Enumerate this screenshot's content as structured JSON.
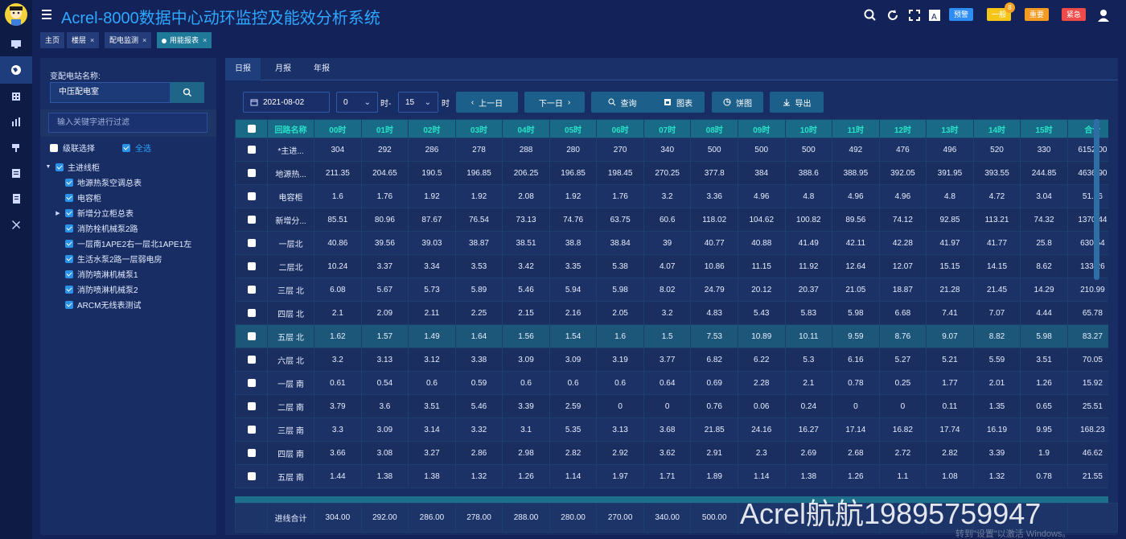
{
  "app": {
    "title": "Acrel-8000数据中心动环监控及能效分析系统"
  },
  "header": {
    "alerts": [
      {
        "label": "预警",
        "color": "#2e8df2"
      },
      {
        "label": "一般",
        "color": "#f5c518",
        "count": "8"
      },
      {
        "label": "重要",
        "color": "#f39a22"
      },
      {
        "label": "紧急",
        "color": "#f04b4b"
      }
    ],
    "icons": [
      "search-icon",
      "refresh-icon",
      "fullscreen-icon",
      "font-size-icon",
      "user-icon"
    ]
  },
  "page_tabs": [
    {
      "label": "主页",
      "closable": false
    },
    {
      "label": "楼层",
      "closable": true
    },
    {
      "label": "配电监测",
      "closable": true
    },
    {
      "label": "用能报表",
      "closable": true,
      "active": true
    }
  ],
  "left": {
    "station_label": "变配电站名称:",
    "station_value": "中压配电室",
    "filter_placeholder": "输入关键字进行过滤",
    "level_select": "级联选择",
    "select_all": "全选",
    "tree": [
      {
        "label": "主进线柜",
        "level": 0,
        "arrow": "▼",
        "checked": true
      },
      {
        "label": "地源热泵空调总表",
        "level": 1,
        "checked": true
      },
      {
        "label": "电容柜",
        "level": 1,
        "checked": true
      },
      {
        "label": "新增分立柜总表",
        "level": 1,
        "arrow": "▶",
        "checked": true
      },
      {
        "label": "消防栓机械泵2路",
        "level": 1,
        "checked": true
      },
      {
        "label": "一层南1APE2右一层北1APE1左",
        "level": 1,
        "checked": true
      },
      {
        "label": "生活水泵2路一层弱电房",
        "level": 1,
        "checked": true
      },
      {
        "label": "消防喷淋机械泵1",
        "level": 1,
        "checked": true
      },
      {
        "label": "消防喷淋机械泵2",
        "level": 1,
        "checked": true
      },
      {
        "label": "ARCM无线表测试",
        "level": 1,
        "checked": true
      }
    ]
  },
  "report": {
    "tabs": [
      "日报",
      "月报",
      "年报"
    ],
    "date": "2021-08-02",
    "hour_from": "0",
    "hour_sep": "时-",
    "hour_to": "15",
    "hour_suffix": "时",
    "buttons": {
      "prev": "上一日",
      "next": "下一日",
      "query": "查询",
      "chart": "图表",
      "pie": "饼图",
      "export": "导出"
    },
    "columns": [
      "回路名称",
      "00时",
      "01时",
      "02时",
      "03时",
      "04时",
      "05时",
      "06时",
      "07时",
      "08时",
      "09时",
      "10时",
      "11时",
      "12时",
      "13时",
      "14时",
      "15时",
      "合计"
    ],
    "rows": [
      [
        "*主进...",
        "304",
        "292",
        "286",
        "278",
        "288",
        "280",
        "270",
        "340",
        "500",
        "500",
        "500",
        "492",
        "476",
        "496",
        "520",
        "330",
        "6152.00"
      ],
      [
        "地源热...",
        "211.35",
        "204.65",
        "190.5",
        "196.85",
        "206.25",
        "196.85",
        "198.45",
        "270.25",
        "377.8",
        "384",
        "388.6",
        "388.95",
        "392.05",
        "391.95",
        "393.55",
        "244.85",
        "4636.90"
      ],
      [
        "电容柜",
        "1.6",
        "1.76",
        "1.92",
        "1.92",
        "2.08",
        "1.92",
        "1.76",
        "3.2",
        "3.36",
        "4.96",
        "4.8",
        "4.96",
        "4.96",
        "4.8",
        "4.72",
        "3.04",
        "51.76"
      ],
      [
        "新增分...",
        "85.51",
        "80.96",
        "87.67",
        "76.54",
        "73.13",
        "74.76",
        "63.75",
        "60.6",
        "118.02",
        "104.62",
        "100.82",
        "89.56",
        "74.12",
        "92.85",
        "113.21",
        "74.32",
        "1370.44"
      ],
      [
        "一层北",
        "40.86",
        "39.56",
        "39.03",
        "38.87",
        "38.51",
        "38.8",
        "38.84",
        "39",
        "40.77",
        "40.88",
        "41.49",
        "42.11",
        "42.28",
        "41.97",
        "41.77",
        "25.8",
        "630.54"
      ],
      [
        "二层北",
        "10.24",
        "3.37",
        "3.34",
        "3.53",
        "3.42",
        "3.35",
        "5.38",
        "4.07",
        "10.86",
        "11.15",
        "11.92",
        "12.64",
        "12.07",
        "15.15",
        "14.15",
        "8.62",
        "133.26"
      ],
      [
        "三层 北",
        "6.08",
        "5.67",
        "5.73",
        "5.89",
        "5.46",
        "5.94",
        "5.98",
        "8.02",
        "24.79",
        "20.12",
        "20.37",
        "21.05",
        "18.87",
        "21.28",
        "21.45",
        "14.29",
        "210.99"
      ],
      [
        "四层 北",
        "2.1",
        "2.09",
        "2.11",
        "2.25",
        "2.15",
        "2.16",
        "2.05",
        "3.2",
        "4.83",
        "5.43",
        "5.83",
        "5.98",
        "6.68",
        "7.41",
        "7.07",
        "4.44",
        "65.78"
      ],
      [
        "五层 北",
        "1.62",
        "1.57",
        "1.49",
        "1.64",
        "1.56",
        "1.54",
        "1.6",
        "1.5",
        "7.53",
        "10.89",
        "10.11",
        "9.59",
        "8.76",
        "9.07",
        "8.82",
        "5.98",
        "83.27"
      ],
      [
        "六层 北",
        "3.2",
        "3.13",
        "3.12",
        "3.38",
        "3.09",
        "3.09",
        "3.19",
        "3.77",
        "6.82",
        "6.22",
        "5.3",
        "6.16",
        "5.27",
        "5.21",
        "5.59",
        "3.51",
        "70.05"
      ],
      [
        "一层 南",
        "0.61",
        "0.54",
        "0.6",
        "0.59",
        "0.6",
        "0.6",
        "0.6",
        "0.64",
        "0.69",
        "2.28",
        "2.1",
        "0.78",
        "0.25",
        "1.77",
        "2.01",
        "1.26",
        "15.92"
      ],
      [
        "二层 南",
        "3.79",
        "3.6",
        "3.51",
        "5.46",
        "3.39",
        "2.59",
        "0",
        "0",
        "0.76",
        "0.06",
        "0.24",
        "0",
        "0",
        "0.11",
        "1.35",
        "0.65",
        "25.51"
      ],
      [
        "三层 南",
        "3.3",
        "3.09",
        "3.14",
        "3.32",
        "3.1",
        "5.35",
        "3.13",
        "3.68",
        "21.85",
        "24.16",
        "16.27",
        "17.14",
        "16.82",
        "17.74",
        "16.19",
        "9.95",
        "168.23"
      ],
      [
        "四层 南",
        "3.66",
        "3.08",
        "3.27",
        "2.86",
        "2.98",
        "2.82",
        "2.92",
        "3.62",
        "2.91",
        "2.3",
        "2.69",
        "2.68",
        "2.72",
        "2.82",
        "3.39",
        "1.9",
        "46.62"
      ],
      [
        "五层 南",
        "1.44",
        "1.38",
        "1.38",
        "1.32",
        "1.26",
        "1.14",
        "1.97",
        "1.71",
        "1.89",
        "1.14",
        "1.38",
        "1.26",
        "1.1",
        "1.08",
        "1.32",
        "0.78",
        "21.55"
      ]
    ],
    "total_label": "进线合计",
    "totals": [
      "304.00",
      "292.00",
      "286.00",
      "278.00",
      "288.00",
      "280.00",
      "270.00",
      "340.00",
      "500.00",
      "",
      "",
      "",
      "",
      "",
      "",
      "",
      ""
    ]
  },
  "watermark": {
    "text": "Acrel航航19895759947",
    "sub": "转到\"设置\"以激活 Windows。"
  }
}
